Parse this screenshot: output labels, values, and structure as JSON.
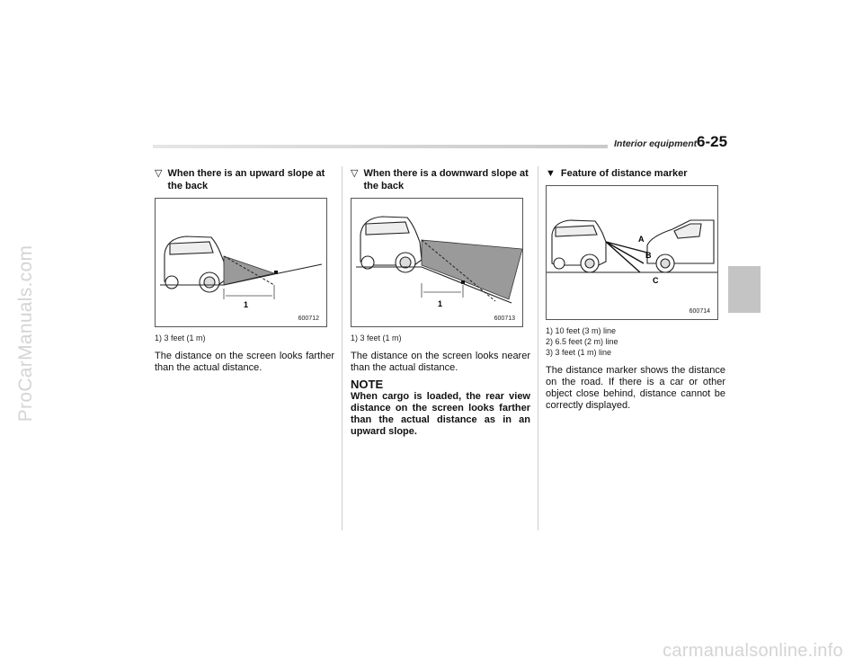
{
  "watermark": "ProCarManuals.com",
  "bottom_watermark": "carmanualsonline.info",
  "header": {
    "section": "Interior equipment",
    "page": "6-25"
  },
  "columns": [
    {
      "heading_marker": "▽",
      "heading": "When there is an upward slope at the back",
      "figure_label": "1",
      "figure_code": "600712",
      "captions": [
        "1)   3 feet (1 m)"
      ],
      "body": "The distance on the screen looks farther than the actual distance."
    },
    {
      "heading_marker": "▽",
      "heading": "When there is a downward slope at the back",
      "figure_label": "1",
      "figure_code": "600713",
      "captions": [
        "1)   3 feet (1 m)"
      ],
      "body": "The distance on the screen looks nearer than the actual distance.",
      "note_title": "NOTE",
      "note_text": "When cargo is loaded, the rear view distance on the screen looks farther than the actual distance as in an upward slope."
    },
    {
      "heading_marker": "▼",
      "heading": "Feature of distance marker",
      "figure_labels": [
        "A",
        "B",
        "C"
      ],
      "figure_code": "600714",
      "captions": [
        "1)   10 feet (3 m) line",
        "2)   6.5 feet (2 m) line",
        "3)   3 feet (1 m) line"
      ],
      "body": "The distance marker shows the distance on the road. If there is a car or other object close behind, distance cannot be correctly displayed."
    }
  ]
}
